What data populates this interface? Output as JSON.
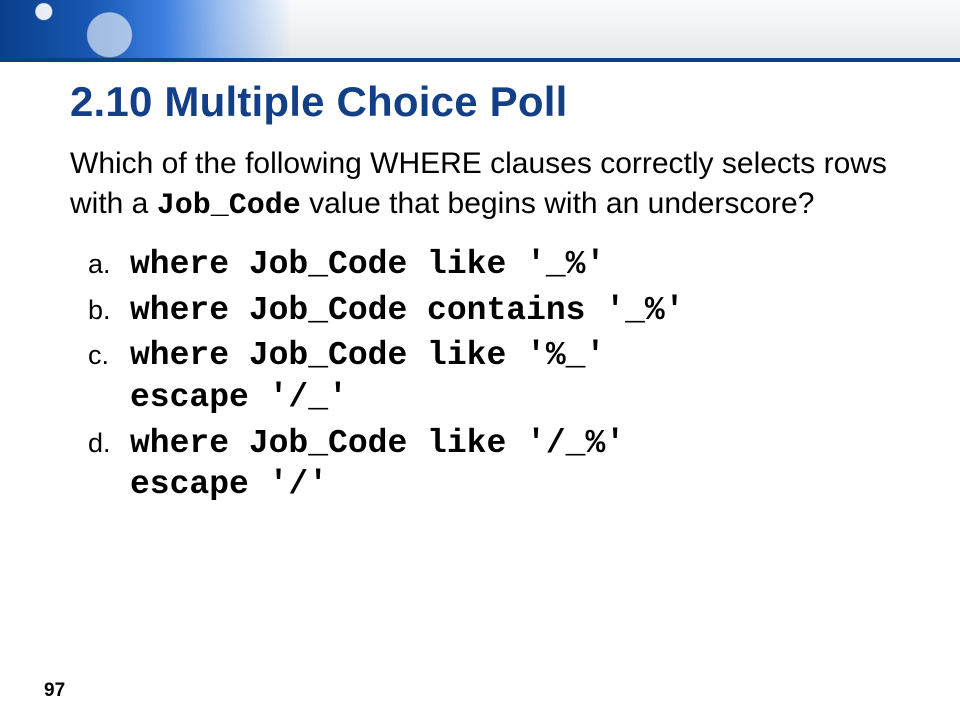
{
  "slide": {
    "title": "2.10 Multiple Choice Poll",
    "question_pre": "Which of the following WHERE clauses correctly selects rows with a ",
    "question_code": "Job_Code",
    "question_post": " value that begins with an underscore?",
    "options": [
      {
        "letter": "a.",
        "code": "where Job_Code like '_%'"
      },
      {
        "letter": "b.",
        "code": "where Job_Code contains '_%'"
      },
      {
        "letter": "c.",
        "code": "where Job_Code like '%_'\nescape '/_'"
      },
      {
        "letter": "d.",
        "code": "where Job_Code like '/_%'\nescape '/'"
      }
    ],
    "page_number": "97"
  }
}
